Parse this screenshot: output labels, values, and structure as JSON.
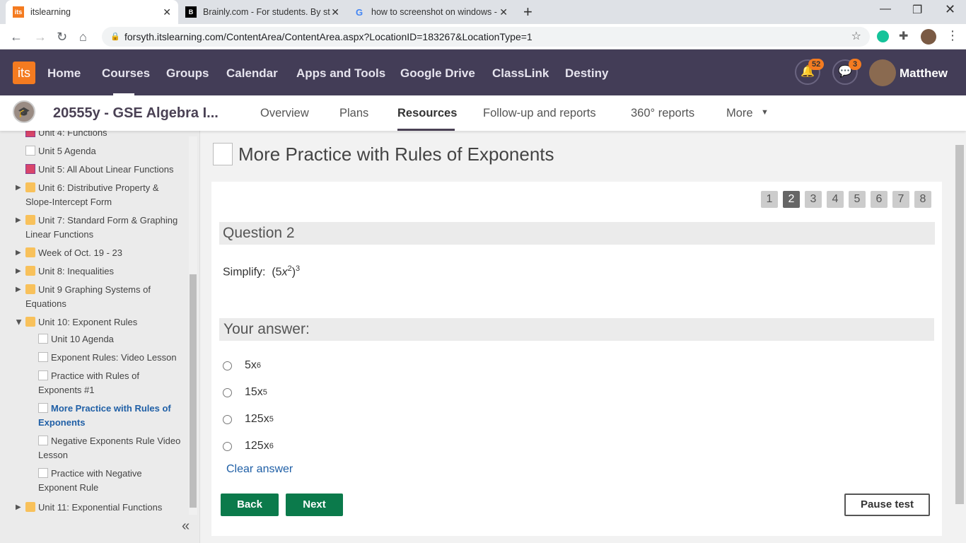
{
  "browser": {
    "tabs": [
      {
        "title": "itslearning",
        "favicon": "its"
      },
      {
        "title": "Brainly.com - For students. By stu",
        "favicon": "B"
      },
      {
        "title": "how to screenshot on windows -",
        "favicon": "G"
      }
    ],
    "url": "forsyth.itslearning.com/ContentArea/ContentArea.aspx?LocationID=183267&LocationType=1"
  },
  "nav": {
    "logo": "its",
    "items": [
      "Home",
      "Courses",
      "Groups",
      "Calendar",
      "Apps and Tools",
      "Google Drive",
      "ClassLink",
      "Destiny"
    ],
    "notifications": "52",
    "messages": "3",
    "user": "Matthew"
  },
  "course": {
    "title": "20555y - GSE Algebra I...",
    "tabs": [
      "Overview",
      "Plans",
      "Resources",
      "Follow-up and reports",
      "360° reports",
      "More"
    ]
  },
  "sidebar": {
    "items": [
      "Unit 4: Functions",
      "Unit 5 Agenda",
      "Unit 5: All About Linear Functions",
      "Unit 6: Distributive Property & Slope-Intercept Form",
      "Unit 7: Standard Form & Graphing Linear Functions",
      "Week of Oct. 19 - 23",
      "Unit 8: Inequalities",
      "Unit 9 Graphing Systems of Equations",
      "Unit 10: Exponent Rules",
      "Unit 10 Agenda",
      "Exponent Rules: Video Lesson",
      "Practice with Rules of Exponents #1",
      "More Practice with Rules of Exponents",
      "Negative Exponents Rule Video Lesson",
      "Practice with Negative Exponent Rule",
      "Unit 11: Exponential Functions"
    ]
  },
  "main": {
    "title": "More Practice with Rules of Exponents",
    "pages": [
      "1",
      "2",
      "3",
      "4",
      "5",
      "6",
      "7",
      "8"
    ],
    "current_page": 2,
    "question_heading": "Question 2",
    "prompt": "Simplify:",
    "expr": {
      "open": "(5",
      "var": "x",
      "inner_exp": "2",
      "close": ")",
      "outer_exp": "3"
    },
    "answer_heading": "Your answer:",
    "options": [
      {
        "base": "5x",
        "exp": "6"
      },
      {
        "base": "15x",
        "exp": "5"
      },
      {
        "base": "125x",
        "exp": "5"
      },
      {
        "base": "125x",
        "exp": "6"
      }
    ],
    "clear": "Clear answer",
    "back": "Back",
    "next": "Next",
    "pause": "Pause test"
  }
}
